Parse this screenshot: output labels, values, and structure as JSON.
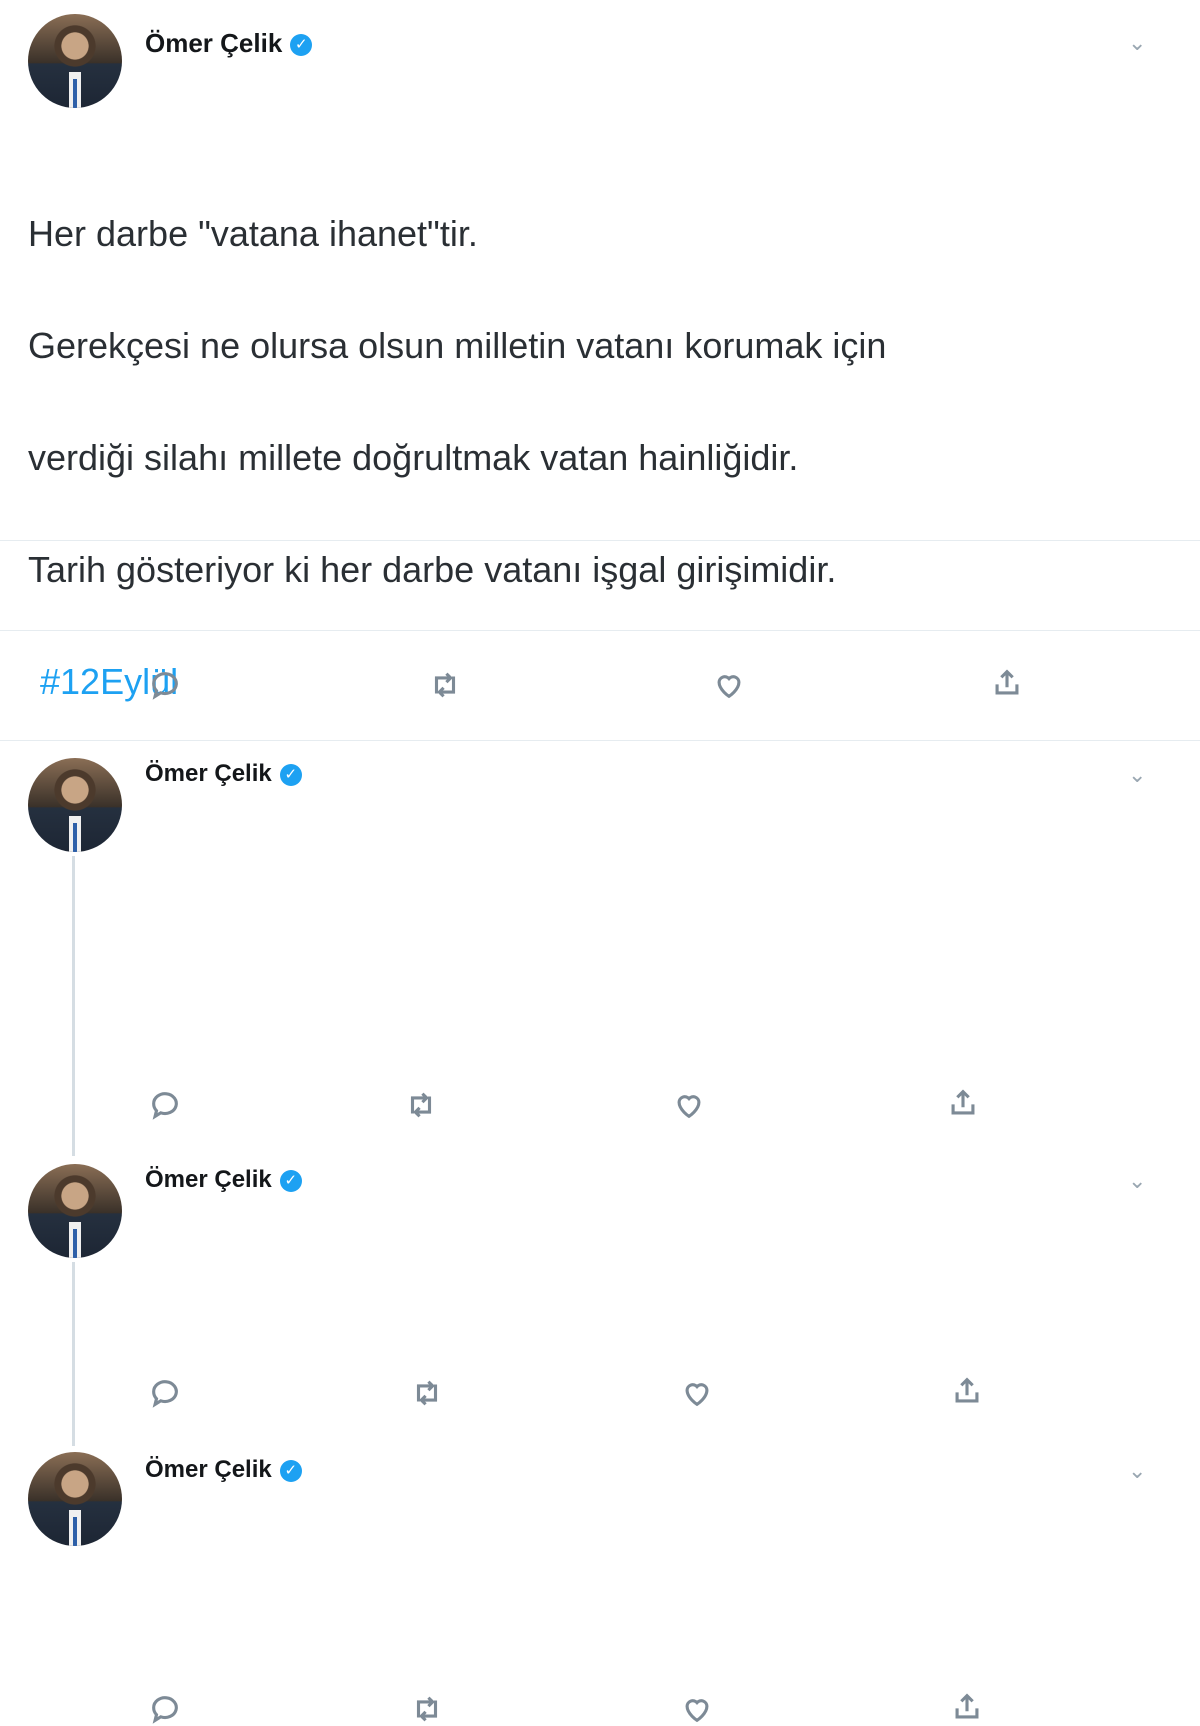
{
  "main_tweet": {
    "author_name": "Ömer Çelik",
    "verified_icon": "verified-badge-icon",
    "handle": "",
    "more_icon": "chevron-down-icon",
    "text_lines": [
      "Her darbe \"vatana ihanet\"tir.",
      "Gerekçesi ne olursa olsun milletin vatanı korumak için",
      "verdiği silahı millete doğrultmak vatan hainliğidir.",
      "Tarih gösteriyor ki her darbe vatanı işgal girişimidir."
    ],
    "hashtag": "#12Eylül",
    "meta": "",
    "stats": [
      {
        "value": "",
        "label": ""
      },
      {
        "value": "",
        "label": ""
      },
      {
        "value": "",
        "label": ""
      }
    ],
    "actions": [
      "reply-icon",
      "retweet-icon",
      "like-icon",
      "share-icon"
    ]
  },
  "replies": [
    {
      "author_name": "Ömer Çelik",
      "handle": "",
      "reply_context": "",
      "text_lines": [
        "",
        "",
        "",
        "",
        ""
      ],
      "hashtag": "",
      "reply_count": "",
      "retweet_count": "",
      "like_count": ""
    },
    {
      "author_name": "Ömer Çelik",
      "handle": "",
      "reply_context": "",
      "text_lines": [
        "",
        "",
        "",
        ""
      ],
      "hashtag": "",
      "reply_count": "",
      "retweet_count": "",
      "like_count": ""
    },
    {
      "author_name": "Ömer Çelik",
      "handle": "",
      "reply_context": "",
      "text_lines": [
        "",
        "",
        "",
        ""
      ],
      "hashtag": "",
      "reply_count": "",
      "retweet_count": "",
      "like_count": ""
    }
  ],
  "colors": {
    "accent": "#1da1f2",
    "text": "#14171a",
    "muted": "#657786"
  }
}
